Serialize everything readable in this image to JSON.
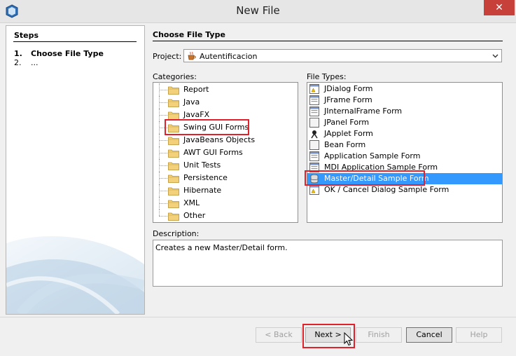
{
  "window": {
    "title": "New File"
  },
  "steps": {
    "title": "Steps",
    "items": [
      {
        "num": "1.",
        "label": "Choose File Type"
      },
      {
        "num": "2.",
        "label": "..."
      }
    ]
  },
  "main": {
    "title": "Choose File Type",
    "project_label": "Project:",
    "project_value": "Autentificacion",
    "categories_label": "Categories:",
    "file_types_label": "File Types:",
    "description_label": "Description:",
    "description_text": "Creates a new Master/Detail form."
  },
  "categories": [
    "Report",
    "Java",
    "JavaFX",
    "Swing GUI Forms",
    "JavaBeans Objects",
    "AWT GUI Forms",
    "Unit Tests",
    "Persistence",
    "Hibernate",
    "XML",
    "Other"
  ],
  "file_types": [
    {
      "label": "JDialog Form",
      "icon": "dialog-form-icon"
    },
    {
      "label": "JFrame Form",
      "icon": "frame-form-icon"
    },
    {
      "label": "JInternalFrame Form",
      "icon": "internal-frame-form-icon"
    },
    {
      "label": "JPanel Form",
      "icon": "panel-form-icon"
    },
    {
      "label": "JApplet Form",
      "icon": "applet-form-icon"
    },
    {
      "label": "Bean Form",
      "icon": "bean-form-icon"
    },
    {
      "label": "Application Sample Form",
      "icon": "application-form-icon"
    },
    {
      "label": "MDI Application Sample Form",
      "icon": "mdi-form-icon"
    },
    {
      "label": "Master/Detail Sample Form",
      "icon": "database-form-icon"
    },
    {
      "label": "OK / Cancel Dialog Sample Form",
      "icon": "dialog-form-icon"
    }
  ],
  "selected_file_type_index": 8,
  "buttons": {
    "back": "< Back",
    "next": "Next >",
    "finish": "Finish",
    "cancel": "Cancel",
    "help": "Help"
  },
  "colors": {
    "selection": "#3399ff",
    "highlight": "#e0202a",
    "close": "#c7413a"
  }
}
